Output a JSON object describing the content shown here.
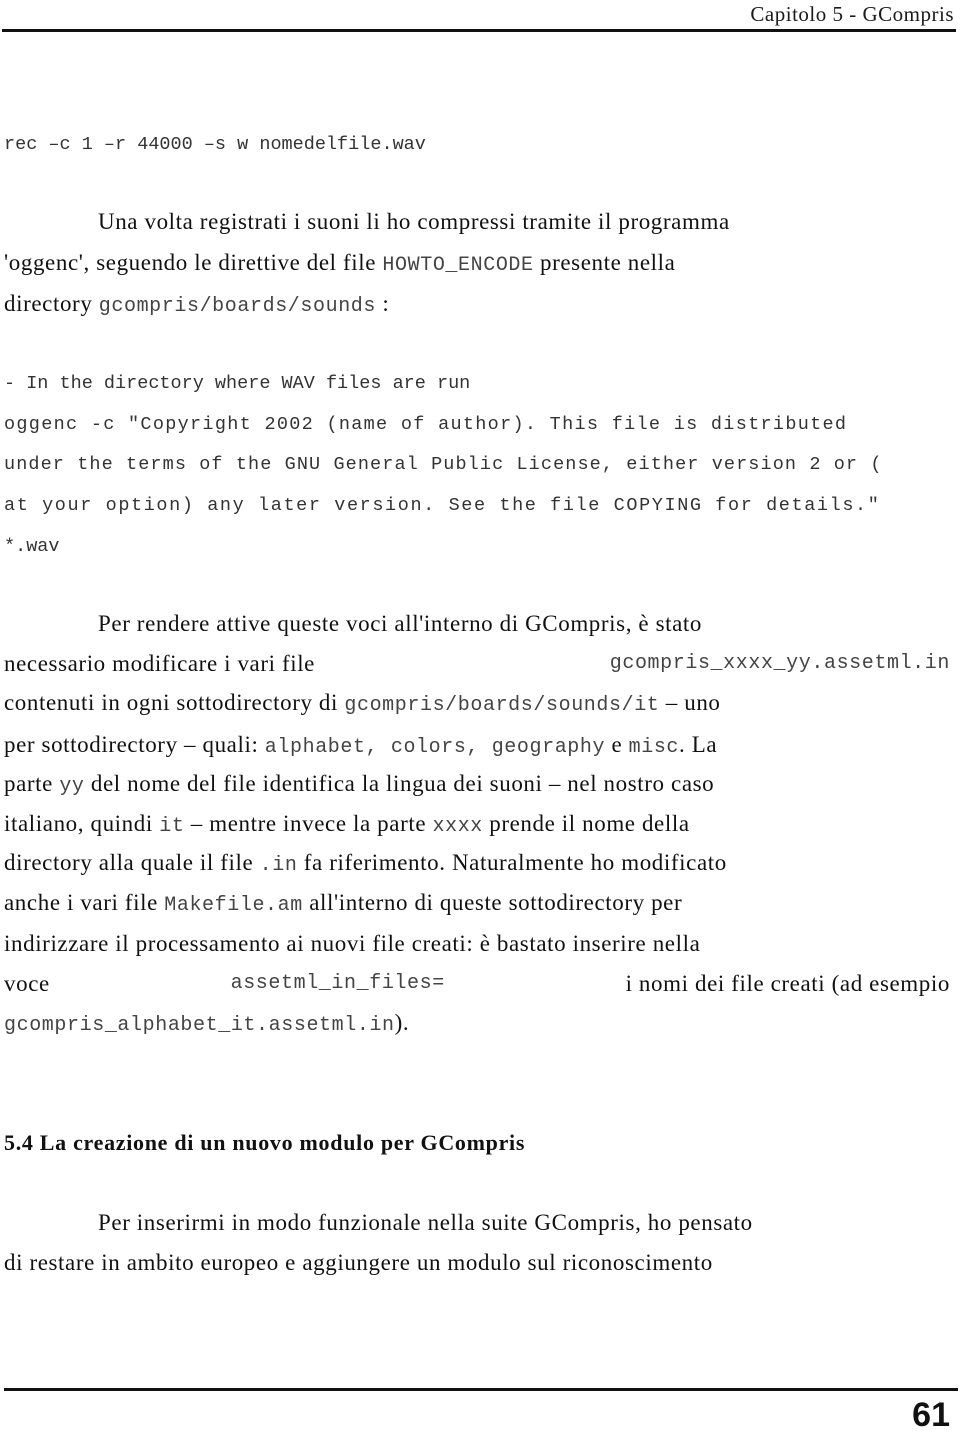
{
  "header": {
    "title": "Capitolo 5 - GCompris"
  },
  "command": "rec –c 1 –r 44000 –s w nomedelfile.wav",
  "paragraph1": {
    "line1": "Una volta registrati i suoni li ho compressi tramite il programma",
    "line2_a": "'oggenc', seguendo le direttive del file ",
    "line2_code": "HOWTO_ENCODE",
    "line2_b": " presente nella",
    "line3_a": "directory ",
    "line3_code": "gcompris/boards/sounds",
    "line3_b": " :"
  },
  "code_block": {
    "lines": [
      "- In the directory where WAV files are run",
      " oggenc -c \"Copyright 2002 (name of author). This file is distributed",
      "under the terms of the GNU General Public License, either version 2 or (",
      "at your option) any later version. See the file COPYING for details.\"",
      "*.wav"
    ]
  },
  "paragraph2": {
    "l1": "Per rendere attive queste voci all'interno di GCompris, è stato",
    "l2_a": "necessario modificare i vari file",
    "l2_code": "gcompris_xxxx_yy.assetml.in",
    "l3_a": "contenuti in ogni sottodirectory di ",
    "l3_code": "gcompris/boards/sounds/it",
    "l3_b": " – uno",
    "l4_a": "per sottodirectory – quali: ",
    "l4_code1": "alphabet",
    "l4_sep1": ", ",
    "l4_code2": "colors",
    "l4_sep2": ", ",
    "l4_code3": "geography",
    "l4_e": " e ",
    "l4_code4": "misc",
    "l4_b": ". La",
    "l5_a": "parte ",
    "l5_code": "yy",
    "l5_b": " del nome del file identifica la lingua dei suoni – nel nostro caso",
    "l6_a": "italiano, quindi ",
    "l6_code": "it",
    "l6_b": " – mentre invece la parte ",
    "l6_code2": "xxxx",
    "l6_c": " prende il nome della",
    "l7_a": "directory alla quale il file ",
    "l7_code": ".in",
    "l7_b": " fa riferimento. Naturalmente ho modificato",
    "l8_a": "anche i vari file ",
    "l8_code": "Makefile.am",
    "l8_b": " all'interno di queste sottodirectory per",
    "l9": "indirizzare il processamento ai nuovi file creati: è bastato inserire nella",
    "l10_a": "voce",
    "l10_code": "assetml_in_files=",
    "l10_b": "i nomi dei file creati (ad esempio",
    "l11_code": "gcompris_alphabet_it.assetml.in",
    "l11_b": ")."
  },
  "section": {
    "heading": "5.4 La creazione di un nuovo modulo per GCompris"
  },
  "paragraph3": {
    "l1": "Per inserirmi in modo funzionale nella suite GCompris, ho pensato",
    "l2": "di restare in ambito europeo e aggiungere un modulo sul riconoscimento"
  },
  "footer": {
    "page_number": "61"
  }
}
